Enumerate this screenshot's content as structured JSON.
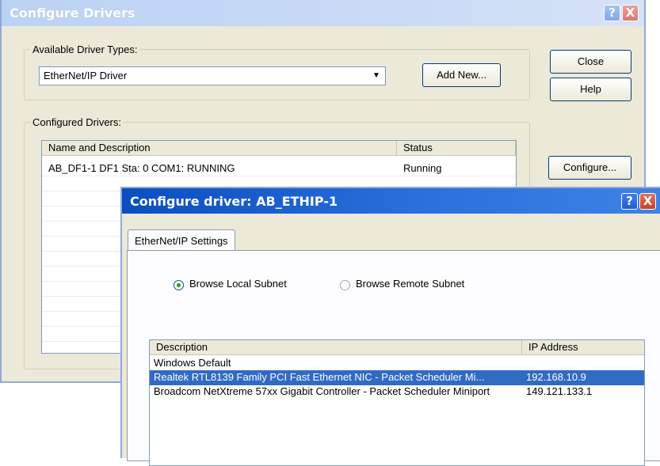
{
  "main_window": {
    "title": "Configure Drivers",
    "help_glyph": "?",
    "close_glyph": "X",
    "available_group": {
      "legend": "Available Driver Types:",
      "selected_driver": "EtherNet/IP Driver",
      "add_new_label": "Add New..."
    },
    "configured_group": {
      "legend": "Configured Drivers:",
      "columns": [
        "Name and Description",
        "Status"
      ],
      "rows": [
        {
          "name": "AB_DF1-1 DF1 Sta: 0 COM1: RUNNING",
          "status": "Running"
        }
      ]
    },
    "buttons": {
      "close": "Close",
      "help": "Help",
      "configure": "Configure..."
    }
  },
  "driver_window": {
    "title": "Configure driver: AB_ETHIP-1",
    "help_glyph": "?",
    "close_glyph": "X",
    "tab_label": "EtherNet/IP Settings",
    "radio_local": "Browse Local Subnet",
    "radio_remote": "Browse Remote Subnet",
    "selected_radio": "local",
    "adapter_columns": [
      "Description",
      "IP Address"
    ],
    "adapters": [
      {
        "description": "Windows Default",
        "ip": ""
      },
      {
        "description": "Realtek RTL8139 Family PCI Fast Ethernet NIC - Packet Scheduler Mi...",
        "ip": "192.168.10.9"
      },
      {
        "description": "Broadcom NetXtreme 57xx Gigabit Controller - Packet Scheduler Miniport",
        "ip": "149.121.133.1"
      }
    ],
    "selected_adapter": 1
  },
  "colors": {
    "selection": "#316ac5",
    "active_titlebar": "#0a4ec0",
    "inactive_titlebar": "#bcd2f4",
    "dialog_face": "#ece9d8"
  },
  "icons": {
    "dropdown": "chevron-down-icon",
    "help": "help-icon",
    "close": "close-icon"
  }
}
